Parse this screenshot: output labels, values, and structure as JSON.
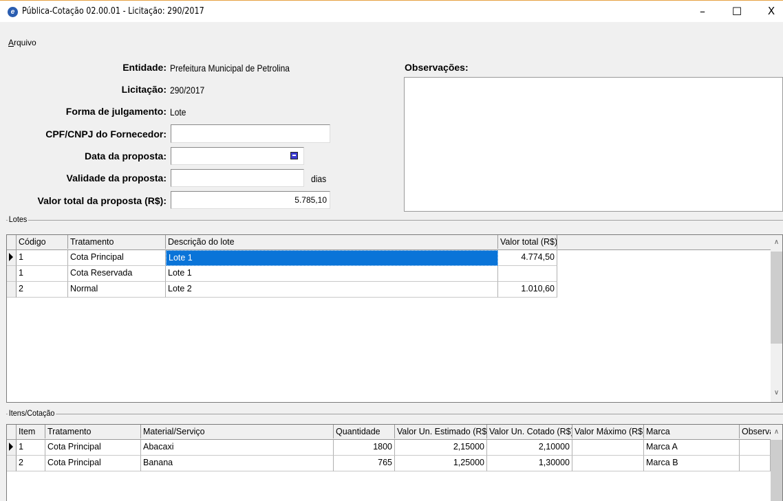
{
  "window": {
    "title": "Pública-Cotação 02.00.01 - Licitação: 290/2017",
    "minimize_glyph": "–",
    "maximize_glyph": "☐",
    "close_glyph": "X"
  },
  "menu": {
    "arquivo": "Arquivo"
  },
  "form": {
    "entidade_label": "Entidade:",
    "entidade_value": "Prefeitura Municipal de Petrolina",
    "licitacao_label": "Licitação:",
    "licitacao_value": "290/2017",
    "forma_label": "Forma de julgamento:",
    "forma_value": "Lote",
    "cpf_label": "CPF/CNPJ do Fornecedor:",
    "cpf_value": "",
    "data_label": "Data da proposta:",
    "data_value": "",
    "validade_label": "Validade da proposta:",
    "validade_value": "",
    "validade_unit": "dias",
    "valor_label": "Valor total da proposta (R$):",
    "valor_value": "5.785,10",
    "observacoes_label": "Observações:",
    "observacoes_value": ""
  },
  "lotes": {
    "group_label": "Lotes",
    "columns": [
      "Código",
      "Tratamento",
      "Descrição do lote",
      "Valor total (R$)"
    ],
    "rows": [
      [
        "1",
        "Cota Principal",
        "Lote 1",
        "4.774,50"
      ],
      [
        "1",
        "Cota Reservada",
        "Lote 1",
        ""
      ],
      [
        "2",
        "Normal",
        "Lote 2",
        "1.010,60"
      ]
    ],
    "selected_row": 0
  },
  "itens": {
    "group_label": "Itens/Cotação",
    "columns": [
      "Item",
      "Tratamento",
      "Material/Serviço",
      "Quantidade",
      "Valor Un. Estimado (R$)",
      "Valor Un. Cotado (R$)",
      "Valor Máximo (R$)",
      "Marca",
      "Observaç"
    ],
    "rows": [
      [
        "1",
        "Cota Principal",
        "Abacaxi",
        "1800",
        "2,15000",
        "2,10000",
        "",
        "Marca A",
        ""
      ],
      [
        "2",
        "Cota Principal",
        "Banana",
        "765",
        "1,25000",
        "1,30000",
        "",
        "Marca B",
        ""
      ]
    ],
    "selected_row": 0
  },
  "icons": {
    "app": "app-logo-icon",
    "calendar": "calendar-icon",
    "row_indicator": "row-pointer-icon",
    "scroll_up": "scroll-up-icon",
    "scroll_down": "scroll-down-icon"
  }
}
